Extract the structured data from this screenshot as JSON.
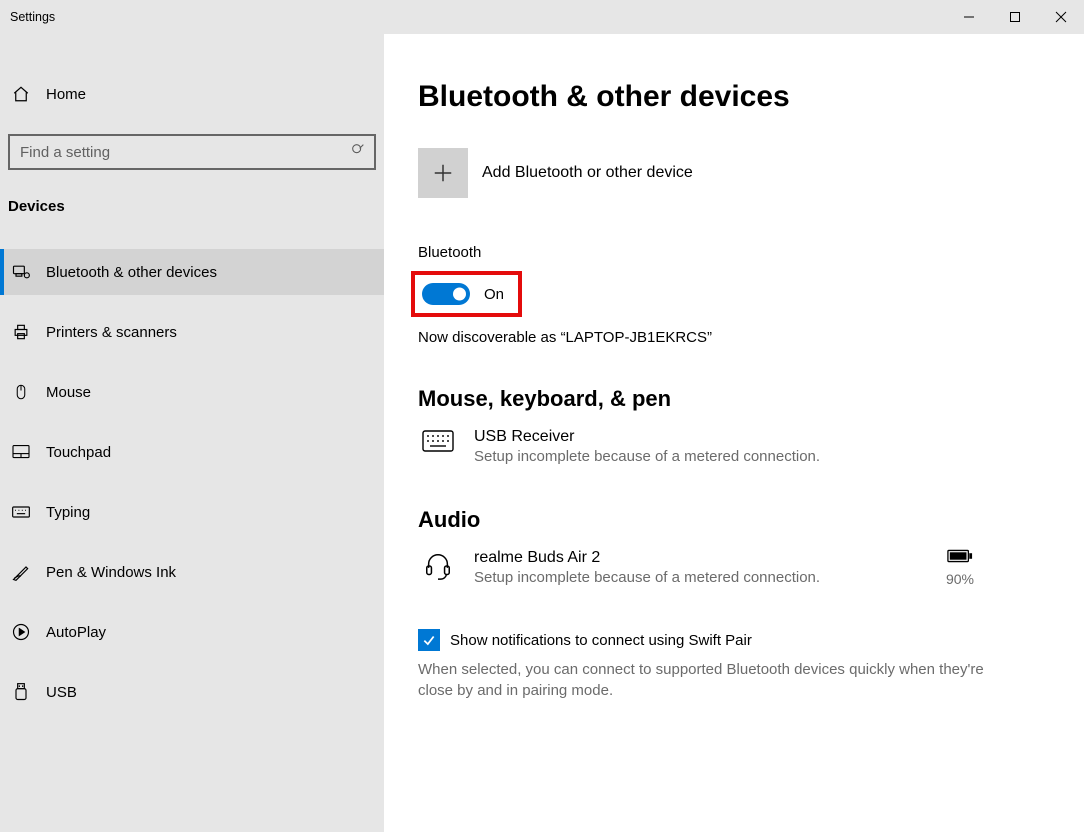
{
  "window": {
    "title": "Settings"
  },
  "sidebar": {
    "home": "Home",
    "search_placeholder": "Find a setting",
    "section": "Devices",
    "items": [
      {
        "label": "Bluetooth & other devices",
        "icon": "bluetooth-devices"
      },
      {
        "label": "Printers & scanners",
        "icon": "printer"
      },
      {
        "label": "Mouse",
        "icon": "mouse"
      },
      {
        "label": "Touchpad",
        "icon": "touchpad"
      },
      {
        "label": "Typing",
        "icon": "keyboard"
      },
      {
        "label": "Pen & Windows Ink",
        "icon": "pen"
      },
      {
        "label": "AutoPlay",
        "icon": "play"
      },
      {
        "label": "USB",
        "icon": "usb"
      }
    ],
    "active_index": 0
  },
  "main": {
    "page_title": "Bluetooth & other devices",
    "add_device": "Add Bluetooth or other device",
    "bluetooth": {
      "label": "Bluetooth",
      "state": "On",
      "discoverable": "Now discoverable as “LAPTOP-JB1EKRCS”"
    },
    "sections": {
      "mkp_title": "Mouse, keyboard, & pen",
      "mkp_device_name": "USB Receiver",
      "mkp_device_status": "Setup incomplete because of a metered connection.",
      "audio_title": "Audio",
      "audio_device_name": "realme Buds Air 2",
      "audio_device_status": "Setup incomplete because of a metered connection.",
      "audio_battery": "90%"
    },
    "swift_pair": {
      "label": "Show notifications to connect using Swift Pair",
      "help": "When selected, you can connect to supported Bluetooth devices quickly when they're close by and in pairing mode."
    }
  }
}
